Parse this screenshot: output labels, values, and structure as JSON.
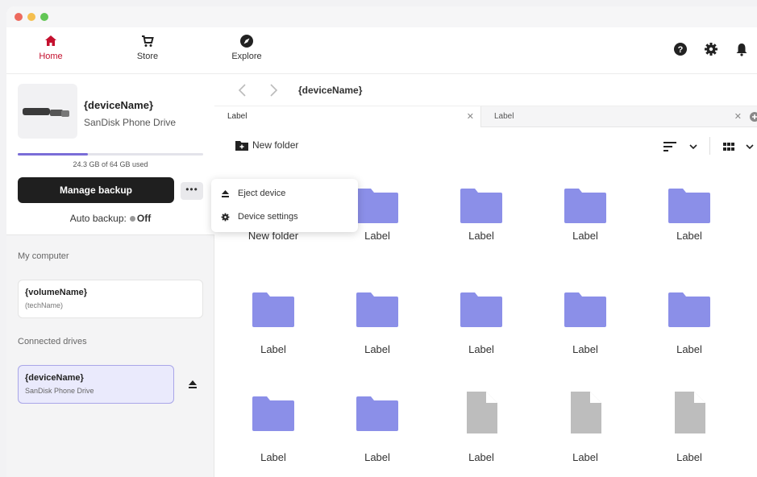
{
  "topnav": {
    "items": [
      {
        "label": "Home",
        "icon": "home-icon",
        "active": true
      },
      {
        "label": "Store",
        "icon": "cart-icon",
        "active": false
      },
      {
        "label": "Explore",
        "icon": "compass-icon",
        "active": false
      }
    ],
    "right_icons": [
      "help-icon",
      "gear-icon",
      "bell-icon"
    ],
    "accent": "#c4102e"
  },
  "device": {
    "name": "{deviceName}",
    "model": "SanDisk Phone Drive",
    "storage_text": "24.3 GB of 64 GB used",
    "storage_used_fraction": 0.38,
    "manage_label": "Manage backup",
    "more_label": "•••",
    "auto_backup_label": "Auto backup:",
    "auto_backup_state": "Off"
  },
  "sidebar": {
    "my_computer_label": "My computer",
    "volume_name": "{volumeName}",
    "volume_sub": "(techName)",
    "connected_label": "Connected drives",
    "drive_name": "{deviceName}",
    "drive_sub": "SanDisk Phone Drive"
  },
  "path": {
    "title": "{deviceName}"
  },
  "tabs": [
    {
      "label": "Label",
      "active": true
    },
    {
      "label": "Label",
      "active": false
    }
  ],
  "toolbar": {
    "new_folder_label": "New folder"
  },
  "menu": {
    "items": [
      {
        "label": "Eject device",
        "icon": "eject-icon"
      },
      {
        "label": "Device settings",
        "icon": "gear-icon"
      }
    ]
  },
  "grid": {
    "folder_color": "#8b8fe8",
    "file_color": "#bdbdbd",
    "items": [
      {
        "label": "New folder",
        "type": "folder"
      },
      {
        "label": "Label",
        "type": "folder"
      },
      {
        "label": "Label",
        "type": "folder"
      },
      {
        "label": "Label",
        "type": "folder"
      },
      {
        "label": "Label",
        "type": "folder"
      },
      {
        "label": "Label",
        "type": "folder"
      },
      {
        "label": "Label",
        "type": "folder"
      },
      {
        "label": "Label",
        "type": "folder"
      },
      {
        "label": "Label",
        "type": "folder"
      },
      {
        "label": "Label",
        "type": "folder"
      },
      {
        "label": "Label",
        "type": "folder"
      },
      {
        "label": "Label",
        "type": "folder"
      },
      {
        "label": "Label",
        "type": "file"
      },
      {
        "label": "Label",
        "type": "file"
      },
      {
        "label": "Label",
        "type": "file"
      }
    ]
  }
}
